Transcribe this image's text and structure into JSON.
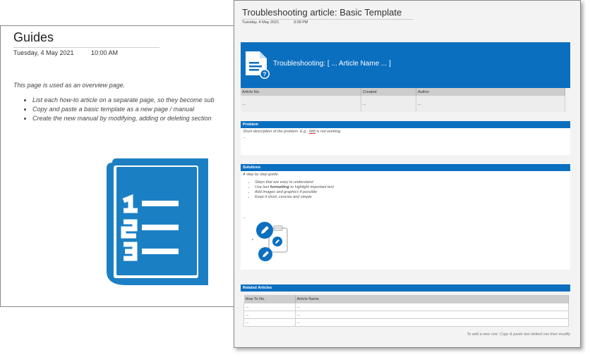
{
  "guides": {
    "title": "Guides",
    "date": "Tuesday, 4 May 2021",
    "time": "10:00 AM",
    "intro": "This page is used as an overview page.",
    "bullets": [
      "List each how-to article on a separate page, so they become sub",
      "Copy and paste a basic template as a new page / manual",
      "Create the new manual by modifying, adding or deleting section"
    ],
    "icon": "numbered-list-book-icon",
    "icon_color": "#1b7fc4"
  },
  "template": {
    "title": "Troubleshooting article: Basic Template",
    "date": "Tuesday, 4 May 2021",
    "time": "3:09 PM",
    "banner": {
      "text": "Troubleshooting: [ ... Article Name ... ]",
      "icon": "document-question-icon",
      "color": "#0b6fc0"
    },
    "meta_table": {
      "headers": [
        "Article No.",
        "Created",
        "Author"
      ],
      "row": [
        "...",
        "...",
        "..."
      ]
    },
    "problem": {
      "heading": "Problem",
      "description_before": "Short description of the problem. E.g.: ",
      "description_link": "Wifi",
      "description_after": " is not working.",
      "placeholder": "..."
    },
    "solutions": {
      "heading": "Solutions",
      "description": "A step by step guide.",
      "bullets": [
        {
          "before": "Steps that are easy to understand",
          "bold": "",
          "after": ""
        },
        {
          "before": "Use text ",
          "bold": "formatting",
          "after": " to highlight important text"
        },
        {
          "before": "Add images and graphics if possible",
          "bold": "",
          "after": ""
        },
        {
          "before": "Keep it short, concise and simple",
          "bold": "",
          "after": ""
        }
      ],
      "placeholder": "...",
      "icon": "edit-clipboard-icon"
    },
    "related": {
      "heading": "Related Articles",
      "headers": [
        "How To No.",
        "Article Name"
      ],
      "rows": [
        [
          "...",
          "..."
        ],
        [
          "...",
          "..."
        ],
        [
          "...",
          "..."
        ]
      ],
      "footnote": "To add a new row: Copy & paste last dotted row then modify"
    }
  }
}
